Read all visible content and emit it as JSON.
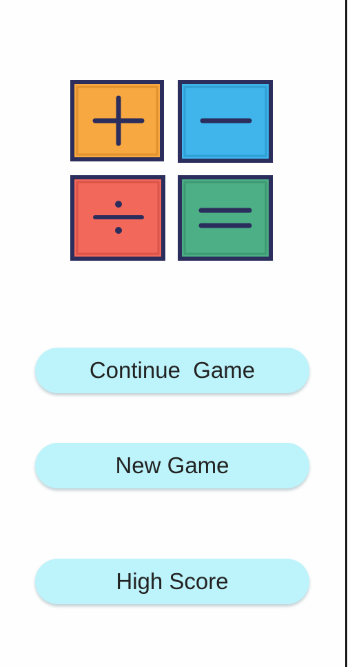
{
  "logo": {
    "tiles": [
      {
        "symbol": "plus-icon",
        "color": "#f7a841"
      },
      {
        "symbol": "minus-icon",
        "color": "#3fb5ec"
      },
      {
        "symbol": "divide-icon",
        "color": "#f2695c"
      },
      {
        "symbol": "equals-icon",
        "color": "#4caf85"
      }
    ],
    "outline_color": "#2b2d5c"
  },
  "menu": {
    "continue_label": "Continue  Game",
    "new_game_label": "New Game",
    "high_score_label": "High Score"
  },
  "colors": {
    "button_bg": "#bdf3fa",
    "background": "#fefefe"
  }
}
